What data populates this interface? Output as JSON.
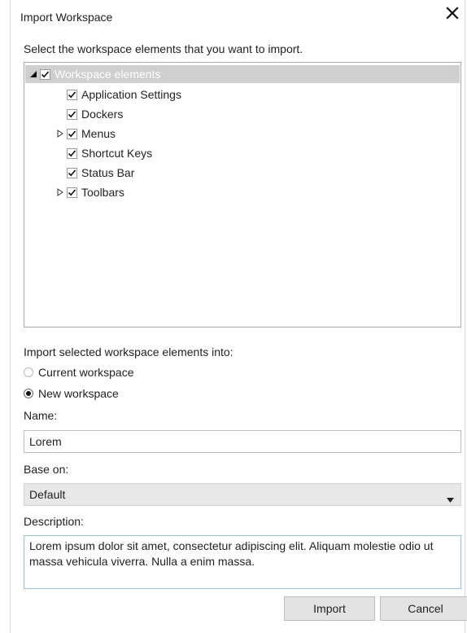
{
  "dialog": {
    "title": "Import Workspace",
    "close_icon": "close-icon"
  },
  "prompt": "Select the workspace elements that you want to import.",
  "tree": {
    "root": {
      "label": "Workspace elements",
      "checked": true,
      "expanded": true
    },
    "items": [
      {
        "label": "Application Settings",
        "checked": true,
        "expandable": false
      },
      {
        "label": "Dockers",
        "checked": true,
        "expandable": false
      },
      {
        "label": "Menus",
        "checked": true,
        "expandable": true
      },
      {
        "label": "Shortcut Keys",
        "checked": true,
        "expandable": false
      },
      {
        "label": "Status Bar",
        "checked": true,
        "expandable": false
      },
      {
        "label": "Toolbars",
        "checked": true,
        "expandable": true
      }
    ]
  },
  "import_into": {
    "label": "Import selected workspace elements into:",
    "options": [
      {
        "label": "Current workspace",
        "selected": false
      },
      {
        "label": "New workspace",
        "selected": true
      }
    ]
  },
  "name": {
    "label": "Name:",
    "value": "Lorem"
  },
  "base_on": {
    "label": "Base on:",
    "value": "Default"
  },
  "description": {
    "label": "Description:",
    "value": "Lorem ipsum dolor sit amet, consectetur adipiscing elit. Aliquam molestie odio ut massa vehicula viverra. Nulla a enim massa."
  },
  "buttons": {
    "import": "Import",
    "cancel": "Cancel"
  },
  "colors": {
    "tree_selection": "#cfcfcf",
    "focus_border": "#8fc1e6"
  }
}
